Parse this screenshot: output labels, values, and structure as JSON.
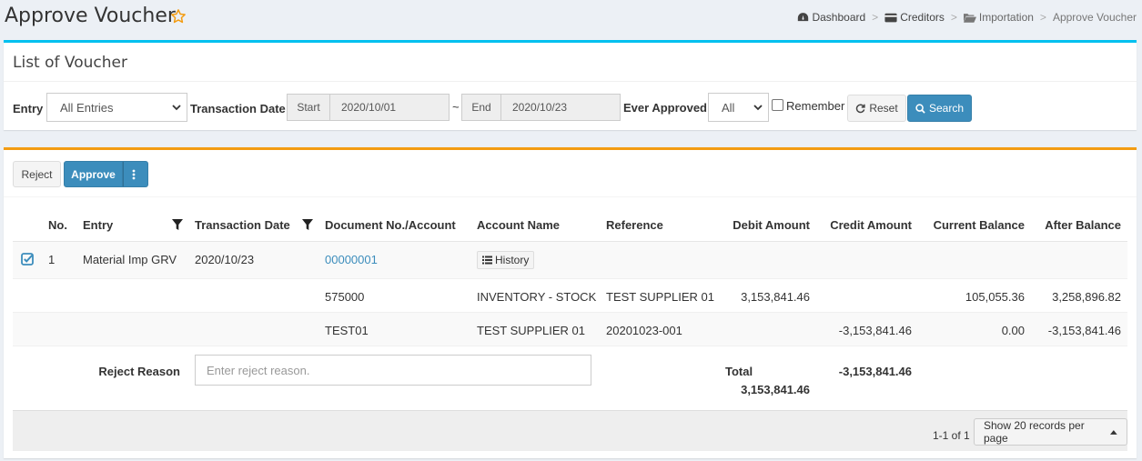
{
  "header": {
    "title": "Approve Voucher",
    "breadcrumb": [
      {
        "label": "Dashboard",
        "icon": "dashboard-icon"
      },
      {
        "label": "Creditors",
        "icon": "credit-card-icon"
      },
      {
        "label": "Importation",
        "icon": "folder-open-icon"
      },
      {
        "label": "Approve Voucher"
      }
    ]
  },
  "filter": {
    "title": "List of Voucher",
    "entry_label": "Entry",
    "entry_value": "All Entries",
    "date_label": "Transaction Date",
    "start_label": "Start",
    "start_value": "2020/10/01",
    "tilde": "~",
    "end_label": "End",
    "end_value": "2020/10/23",
    "approved_label": "Ever Approved",
    "approved_value": "All",
    "remember_label": "Remember",
    "reset_label": "Reset",
    "search_label": "Search"
  },
  "toolbar": {
    "reject_label": "Reject",
    "approve_label": "Approve"
  },
  "table": {
    "columns": [
      "No.",
      "Entry",
      "Transaction Date",
      "Document No./Account",
      "Account Name",
      "Reference",
      "Debit Amount",
      "Credit Amount",
      "Current Balance",
      "After Balance"
    ],
    "voucher": {
      "no": "1",
      "entry": "Material Imp GRV",
      "date": "2020/10/23",
      "document": "00000001",
      "history_label": "History"
    },
    "lines": [
      {
        "account": "575000",
        "name": "INVENTORY - STOCK",
        "reference": "TEST SUPPLIER 01",
        "debit": "3,153,841.46",
        "credit": "",
        "current": "105,055.36",
        "after": "3,258,896.82"
      },
      {
        "account": "TEST01",
        "name": "TEST SUPPLIER 01",
        "reference": "20201023-001",
        "debit": "",
        "credit": "-3,153,841.46",
        "current": "0.00",
        "after": "-3,153,841.46"
      }
    ],
    "reject_reason_label": "Reject Reason",
    "reject_reason_placeholder": "Enter reject reason.",
    "total_label": "Total",
    "total_debit": "3,153,841.46",
    "total_credit": "-3,153,841.46"
  },
  "pager": {
    "range": "1-1 of 1",
    "per_page_label": "Show 20 records per page"
  },
  "colors": {
    "info_accent": "#00c0ef",
    "warning_accent": "#f39c12",
    "primary": "#3c8dbc",
    "star": "#f39c12"
  }
}
